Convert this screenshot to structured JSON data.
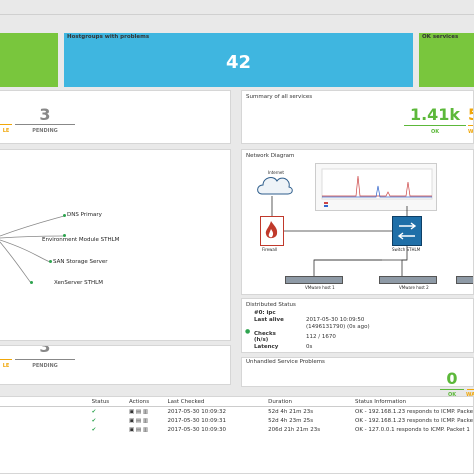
{
  "tiles": {
    "hostgroups_title": "Hostgroups with problems",
    "hostgroups_value": "42",
    "ok_services_title": "OK services"
  },
  "host_summary": {
    "pending_value": "3",
    "pending_label": "PENDING",
    "partial_label": "LE"
  },
  "service_summary": {
    "title": "Summary of all services",
    "ok_value": "1.41k",
    "ok_label": "OK",
    "warning_value": "5",
    "warning_label": "WA"
  },
  "topology": {
    "nodes": [
      "DNS Primary",
      "Environment Module STHLM",
      "SAN Storage Server",
      "XenServer STHLM"
    ]
  },
  "network": {
    "title": "Network Diagram",
    "internet": "Internet",
    "firewall": "Firewall",
    "switch": "Switch STHLM",
    "vmware1": "VMware host 1",
    "vmware2": "VMware host 2"
  },
  "distributed": {
    "title": "Distributed Status",
    "node": "#0: ipc",
    "last_alive_label": "Last alive",
    "last_alive_value": "2017-05-30 10:09:50",
    "last_alive_sub": "(1496131790) (0s ago)",
    "checks_label": "Checks",
    "checks_sub": "(h/s)",
    "checks_value": "112 / 1670",
    "latency_label": "Latency",
    "latency_value": "0s"
  },
  "host_summary2": {
    "pending_value": "3",
    "pending_label": "PENDING",
    "partial_label": "LE"
  },
  "unhandled": {
    "title": "Unhandled Service Problems",
    "ok_value": "0",
    "ok_label": "OK",
    "other_label": "WA"
  },
  "table": {
    "headers": [
      "Status",
      "Actions",
      "Last Checked",
      "Duration",
      "Status Information"
    ],
    "rows": [
      {
        "last_checked": "2017-05-30 10:09:32",
        "duration": "52d 4h 21m 23s",
        "info": "OK - 192.168.1.23 responds to ICMP. Packe"
      },
      {
        "last_checked": "2017-05-30 10:09:31",
        "duration": "52d 4h 23m 25s",
        "info": "OK - 192.168.1.23 responds to ICMP. Packe"
      },
      {
        "last_checked": "2017-05-30 10:09:30",
        "duration": "206d 21h 21m 23s",
        "info": "OK - 127.0.0.1 responds to ICMP. Packet 1"
      }
    ]
  },
  "colors": {
    "green": "#79c63d",
    "blue": "#3fb6e0",
    "pending": "#888888",
    "ok_text": "#5cb83a",
    "warn_text": "#f0a70a"
  }
}
